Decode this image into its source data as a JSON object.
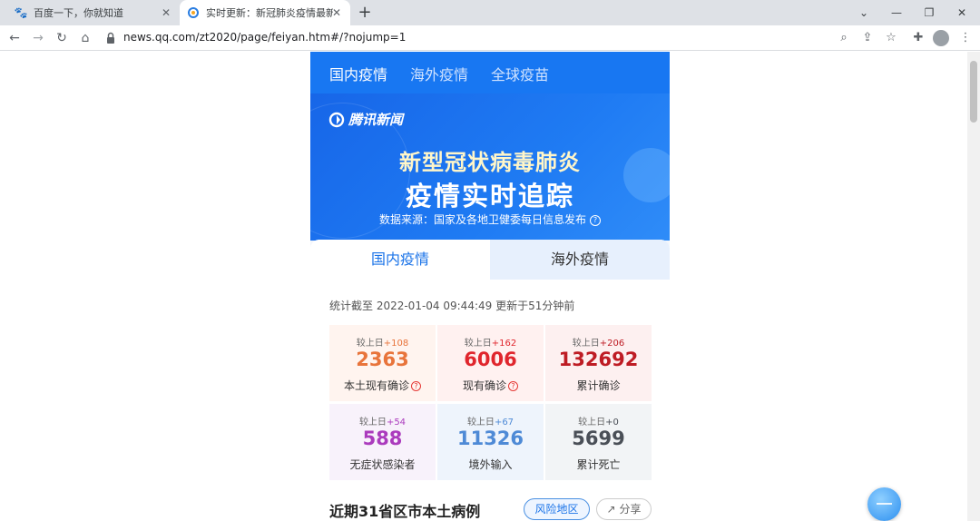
{
  "browser": {
    "tabs": [
      {
        "title": "百度一下，你就知道",
        "favicon": "baidu-paw-icon",
        "active": false
      },
      {
        "title": "实时更新：新冠肺炎疫情最新动态",
        "favicon": "tencent-news-icon",
        "active": true
      }
    ],
    "url": "news.qq.com/zt2020/page/feiyan.htm#/?nojump=1"
  },
  "page": {
    "top_nav": [
      "国内疫情",
      "海外疫情",
      "全球疫苗"
    ],
    "brand": "腾讯新闻",
    "headline_line1": "新型冠状病毒肺炎",
    "headline_line2": "疫情实时追踪",
    "source": "数据来源：国家及各地卫健委每日信息发布",
    "sub_tabs": [
      "国内疫情",
      "海外疫情"
    ],
    "timestamp": "统计截至 2022-01-04 09:44:49 更新于51分钟前",
    "stats": [
      {
        "delta_label": "较上日",
        "delta": "+108",
        "value": "2363",
        "label": "本土现有确诊",
        "has_help": true,
        "color": "#e8743b",
        "bg": "#fff4ef"
      },
      {
        "delta_label": "较上日",
        "delta": "+162",
        "value": "6006",
        "label": "现有确诊",
        "has_help": true,
        "color": "#e0262d",
        "bg": "#fff1f0"
      },
      {
        "delta_label": "较上日",
        "delta": "+206",
        "value": "132692",
        "label": "累计确诊",
        "has_help": false,
        "color": "#be1c24",
        "bg": "#fdf0f0"
      },
      {
        "delta_label": "较上日",
        "delta": "+54",
        "value": "588",
        "label": "无症状感染者",
        "has_help": false,
        "color": "#ab3bbd",
        "bg": "#f8f2fb"
      },
      {
        "delta_label": "较上日",
        "delta": "+67",
        "value": "11326",
        "label": "境外输入",
        "has_help": false,
        "color": "#4e8ad6",
        "bg": "#eef4fc"
      },
      {
        "delta_label": "较上日",
        "delta": "+0",
        "value": "5699",
        "label": "累计死亡",
        "has_help": false,
        "color": "#4a4f57",
        "bg": "#f2f4f6"
      }
    ],
    "section_title": "近期31省区市本土病例",
    "risk_button": "风险地区",
    "share_button": "分享",
    "accent_color": "#1877f2"
  }
}
